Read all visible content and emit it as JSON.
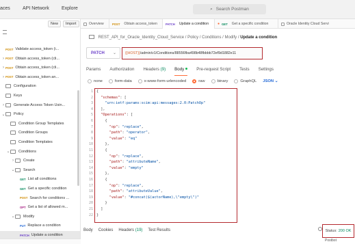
{
  "topbar": {
    "nav": [
      "aces",
      "API Network",
      "Explore"
    ],
    "search_placeholder": "Search Postman"
  },
  "sidebar": {
    "new_label": "New",
    "import_label": "Import",
    "rows": [
      {
        "type": "request",
        "method": "POST",
        "label": "Validate access_token (i..."
      },
      {
        "type": "request",
        "method": "POST",
        "label": "Obtain access_token (cli...",
        "chev": "›"
      },
      {
        "type": "request",
        "method": "POST",
        "label": "Obtain access_token (cli...",
        "chev": "›"
      },
      {
        "type": "request",
        "method": "POST",
        "label": "Obtain access_token an...",
        "chev": "›"
      },
      {
        "type": "folder",
        "label": "Configuration"
      },
      {
        "type": "folder",
        "label": "Keys"
      },
      {
        "type": "folder",
        "label": "Generate Access Token Usin...",
        "chev": "›"
      },
      {
        "type": "folder",
        "label": "Policy",
        "chev": "⌄"
      },
      {
        "type": "folder",
        "label": "Condition Group Templates",
        "indent": 1
      },
      {
        "type": "folder",
        "label": "Condition Groups",
        "indent": 1
      },
      {
        "type": "folder",
        "label": "Condition Templates",
        "indent": 1
      },
      {
        "type": "folder",
        "label": "Conditions",
        "indent": 1,
        "chev": "⌄"
      },
      {
        "type": "folder",
        "label": "Create",
        "indent": 2,
        "chev": "›"
      },
      {
        "type": "folder",
        "label": "Search",
        "indent": 2,
        "chev": "⌄"
      },
      {
        "type": "request",
        "method": "GET",
        "label": "List all conditions",
        "indent": 3
      },
      {
        "type": "request",
        "method": "GET",
        "label": "Get a specific condition",
        "indent": 3
      },
      {
        "type": "request",
        "method": "POST",
        "label": "Search for conditions ...",
        "indent": 3
      },
      {
        "type": "request",
        "method": "OPT",
        "label": "Get a list of allowed m...",
        "indent": 3
      },
      {
        "type": "folder",
        "label": "Modify",
        "indent": 2,
        "chev": "⌄"
      },
      {
        "type": "request",
        "method": "PUT",
        "label": "Replace a condition",
        "indent": 3
      },
      {
        "type": "request",
        "method": "PATCH",
        "label": "Update a condition",
        "indent": 3,
        "selected": true
      }
    ]
  },
  "tabs": [
    {
      "label": "Overview",
      "method": ""
    },
    {
      "label": "Obtain access_token",
      "method": "POST"
    },
    {
      "label": "Update a condition",
      "method": "PATCH",
      "active": true
    },
    {
      "label": "Get a specific condition",
      "method": "GET"
    },
    {
      "label": "Oracle Identity Cloud Servi",
      "method": ""
    }
  ],
  "breadcrumb": {
    "parts": [
      "REST_API_for_Oracle_Identity_Cloud_Service",
      "Policy",
      "Conditions",
      "Modify"
    ],
    "current": "Update a condition",
    "separator": "/"
  },
  "request": {
    "method": "PATCH",
    "url_var": "{{HOST}}",
    "url_rest": "/admin/v1/Conditions/88556fba498b48fbbbb72ef9d1882e11"
  },
  "req_tabs": [
    {
      "label": "Params"
    },
    {
      "label": "Authorization"
    },
    {
      "label": "Headers",
      "count": "(9)"
    },
    {
      "label": "Body",
      "active": true,
      "dot": true
    },
    {
      "label": "Pre-request Script"
    },
    {
      "label": "Tests"
    },
    {
      "label": "Settings"
    }
  ],
  "body_types": [
    "none",
    "form-data",
    "x-www-form-urlencoded",
    "raw",
    "binary",
    "GraphQL"
  ],
  "body_selected": "raw",
  "format": "JSON",
  "code_lines": [
    [
      [
        "p",
        "{"
      ]
    ],
    [
      [
        "p",
        "  "
      ],
      [
        "k",
        "\"schemas\""
      ],
      [
        "p",
        ": ["
      ]
    ],
    [
      [
        "p",
        "    "
      ],
      [
        "s",
        "\"urn:ietf:params:scim:api:messages:2.0:PatchOp\""
      ]
    ],
    [
      [
        "p",
        "  ],"
      ]
    ],
    [
      [
        "p",
        "  "
      ],
      [
        "k",
        "\"Operations\""
      ],
      [
        "p",
        ": ["
      ]
    ],
    [
      [
        "p",
        "    {"
      ]
    ],
    [
      [
        "p",
        "      "
      ],
      [
        "k",
        "\"op\""
      ],
      [
        "p",
        ": "
      ],
      [
        "s",
        "\"replace\""
      ],
      [
        "p",
        ","
      ]
    ],
    [
      [
        "p",
        "      "
      ],
      [
        "k",
        "\"path\""
      ],
      [
        "p",
        ": "
      ],
      [
        "s",
        "\"operator\""
      ],
      [
        "p",
        ","
      ]
    ],
    [
      [
        "p",
        "      "
      ],
      [
        "k",
        "\"value\""
      ],
      [
        "p",
        ": "
      ],
      [
        "s",
        "\"eq\""
      ]
    ],
    [
      [
        "p",
        "    },"
      ]
    ],
    [
      [
        "p",
        "    {"
      ]
    ],
    [
      [
        "p",
        "      "
      ],
      [
        "k",
        "\"op\""
      ],
      [
        "p",
        ": "
      ],
      [
        "s",
        "\"replace\""
      ],
      [
        "p",
        ","
      ]
    ],
    [
      [
        "p",
        "      "
      ],
      [
        "k",
        "\"path\""
      ],
      [
        "p",
        ": "
      ],
      [
        "s",
        "\"attributeName\""
      ],
      [
        "p",
        ","
      ]
    ],
    [
      [
        "p",
        "      "
      ],
      [
        "k",
        "\"value\""
      ],
      [
        "p",
        ": "
      ],
      [
        "s",
        "\"empty\""
      ]
    ],
    [
      [
        "p",
        "    },"
      ]
    ],
    [
      [
        "p",
        "    {"
      ]
    ],
    [
      [
        "p",
        "      "
      ],
      [
        "k",
        "\"op\""
      ],
      [
        "p",
        ": "
      ],
      [
        "s",
        "\"replace\""
      ],
      [
        "p",
        ","
      ]
    ],
    [
      [
        "p",
        "      "
      ],
      [
        "k",
        "\"path\""
      ],
      [
        "p",
        ": "
      ],
      [
        "s",
        "\"attributeValue\""
      ],
      [
        "p",
        ","
      ]
    ],
    [
      [
        "p",
        "      "
      ],
      [
        "k",
        "\"value\""
      ],
      [
        "p",
        ": "
      ],
      [
        "s",
        "\"#concat($(actorName),\\\"empty\\\")\""
      ]
    ],
    [
      [
        "p",
        "    }"
      ]
    ],
    [
      [
        "p",
        "  ]"
      ]
    ],
    [
      [
        "p",
        "}"
      ]
    ]
  ],
  "bottom": {
    "tabs": [
      {
        "label": "Body"
      },
      {
        "label": "Cookies"
      },
      {
        "label": "Headers",
        "count": "(19)"
      },
      {
        "label": "Test Results"
      }
    ],
    "status_label": "Status:",
    "status_value": "200 OK",
    "postbot": "Postbot"
  },
  "colors": {
    "highlight_border": "#b3282d",
    "accent": "#ff6c37",
    "patch": "#6b3fc9",
    "success": "#00875a"
  }
}
